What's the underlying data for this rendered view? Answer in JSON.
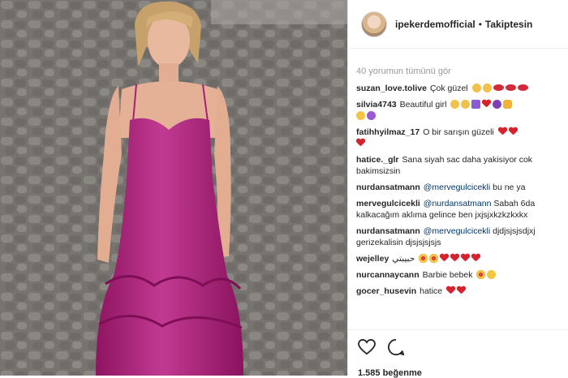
{
  "post": {
    "username": "ipekerdemofficial",
    "separator": "•",
    "follow_status": "Takiptesin"
  },
  "comments": {
    "load_more": "40 yorumun tümünü gör",
    "items": [
      {
        "user": "suzan_love.tolive",
        "text": "Çok güzel",
        "emoji": [
          "clap-emoji",
          "clap-emoji",
          "lips-emoji",
          "lips-emoji",
          "lips-emoji"
        ]
      },
      {
        "user": "silvia4743",
        "text": "Beautiful girl",
        "emoji": [
          "clap-emoji",
          "clap-emoji",
          "music-emoji",
          "heart-emoji",
          "purple-face-emoji",
          "thumbs-up-emoji",
          "smile-emoji",
          "purple-heart-emoji"
        ]
      },
      {
        "user": "fatihhyilmaz_17",
        "text": "O bir sarışın güzeli",
        "emoji": [
          "heart-emoji",
          "heart-emoji",
          "heart-emoji"
        ]
      },
      {
        "user": "hatice._glr",
        "text": "Sana siyah sac daha yakisiyor cok bakimsizsin",
        "emoji": []
      },
      {
        "user": "nurdansatmann",
        "mention": "@mervegulcicekli",
        "text": "bu ne ya",
        "emoji": []
      },
      {
        "user": "mervegulcicekli",
        "mention": "@nurdansatmann",
        "text": "Sabah 6da kalkacağım aklıma gelince ben jxjsjxkzkzkxkx",
        "emoji": []
      },
      {
        "user": "nurdansatmann",
        "mention": "@mervegulcicekli",
        "text": "djdjsjsjsdjxj gerizekalisin djsjsjsjsjs",
        "emoji": []
      },
      {
        "user": "wejelley",
        "text": "حبيبتي",
        "emoji": [
          "heart-eyes-emoji",
          "heart-eyes-emoji",
          "heart-emoji",
          "heart-emoji",
          "heart-emoji",
          "heart-emoji"
        ]
      },
      {
        "user": "nurcannaycann",
        "text": "Barbie bebek",
        "emoji": [
          "heart-eyes-emoji",
          "smile-emoji"
        ]
      },
      {
        "user": "gocer_husevin",
        "text": "hatice",
        "emoji": [
          "heart-emoji",
          "heart-emoji"
        ]
      }
    ]
  },
  "actions": {
    "like_icon": "heart-outline-icon",
    "comment_icon": "comment-bubble-icon",
    "likes_text": "1.585 beğenme"
  },
  "colors": {
    "dress": "#b4247f",
    "cobblestone": "#7f7c7a",
    "heart": "#d6222c",
    "mention": "#003569"
  }
}
